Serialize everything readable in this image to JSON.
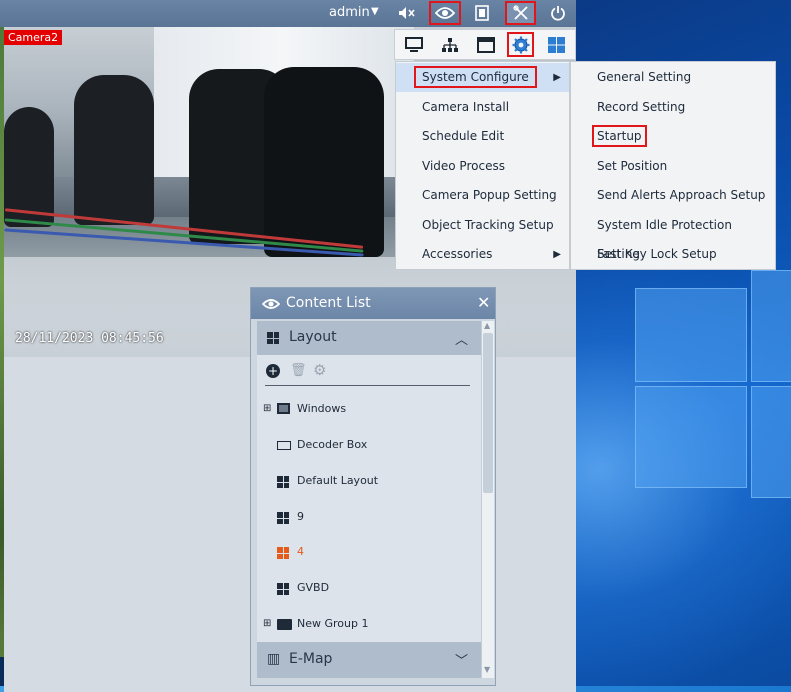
{
  "topbar": {
    "user": "admin"
  },
  "camera": {
    "label": "Camera2",
    "timestamp": "28/11/2023 08:45:56"
  },
  "menu_main": {
    "items": [
      {
        "label": "System Configure",
        "has_submenu": true
      },
      {
        "label": "Camera Install"
      },
      {
        "label": "Schedule Edit"
      },
      {
        "label": "Video Process"
      },
      {
        "label": "Camera Popup Setting"
      },
      {
        "label": "Object Tracking Setup"
      },
      {
        "label": "Accessories",
        "has_submenu": true
      }
    ]
  },
  "menu_sub": {
    "items": [
      {
        "label": "General Setting"
      },
      {
        "label": "Record Setting"
      },
      {
        "label": "Startup"
      },
      {
        "label": "Set Position"
      },
      {
        "label": "Send Alerts Approach Setup"
      },
      {
        "label": "System Idle Protection Setting"
      },
      {
        "label": "Fast Key Lock Setup"
      }
    ]
  },
  "panel": {
    "title": "Content List",
    "layout_section": "Layout",
    "emap_section": "E-Map",
    "tree": [
      {
        "label": "Windows",
        "expandable": true
      },
      {
        "label": "Decoder Box"
      },
      {
        "label": "Default Layout"
      },
      {
        "label": "9"
      },
      {
        "label": "4",
        "selected": true
      },
      {
        "label": "GVBD"
      },
      {
        "label": "New Group 1",
        "expandable": true
      }
    ]
  },
  "colors": {
    "highlight": "#e0161b",
    "selected_text": "#e55c1a",
    "topbar": "#5a7495"
  }
}
